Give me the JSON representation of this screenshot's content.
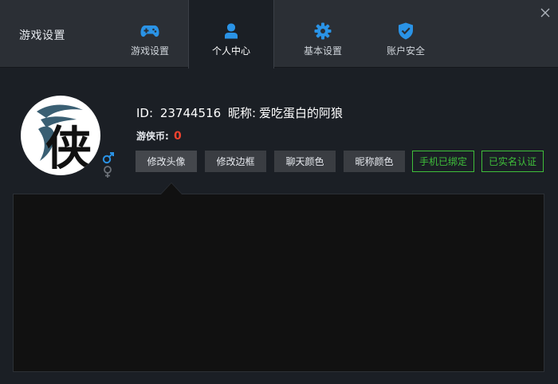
{
  "window": {
    "title": "游戏设置",
    "close_icon": "close-icon"
  },
  "tabs": [
    {
      "label": "游戏设置",
      "icon": "gamepad-icon"
    },
    {
      "label": "个人中心",
      "icon": "user-icon"
    },
    {
      "label": "基本设置",
      "icon": "gear-icon"
    },
    {
      "label": "账户安全",
      "icon": "shield-check-icon"
    }
  ],
  "active_tab": "个人中心",
  "profile": {
    "id_label": "ID:",
    "id_value": "23744516",
    "nickname_label": "昵称:",
    "nickname_value": "爱吃蛋白的阿狼",
    "coin_label": "游侠币:",
    "coin_value": "0",
    "avatar_text": "侠",
    "gender_male_icon": "male-icon",
    "gender_female_icon": "female-icon"
  },
  "actions": {
    "change_avatar": "修改头像",
    "change_frame": "修改边框",
    "chat_color": "聊天颜色",
    "nick_color": "昵称颜色"
  },
  "badges": {
    "phone_bound": "手机已绑定",
    "real_name": "已实名认证"
  },
  "colors": {
    "accent_blue": "#2a93e6",
    "badge_green": "#3fbf3a",
    "coin_red": "#f0422e"
  }
}
